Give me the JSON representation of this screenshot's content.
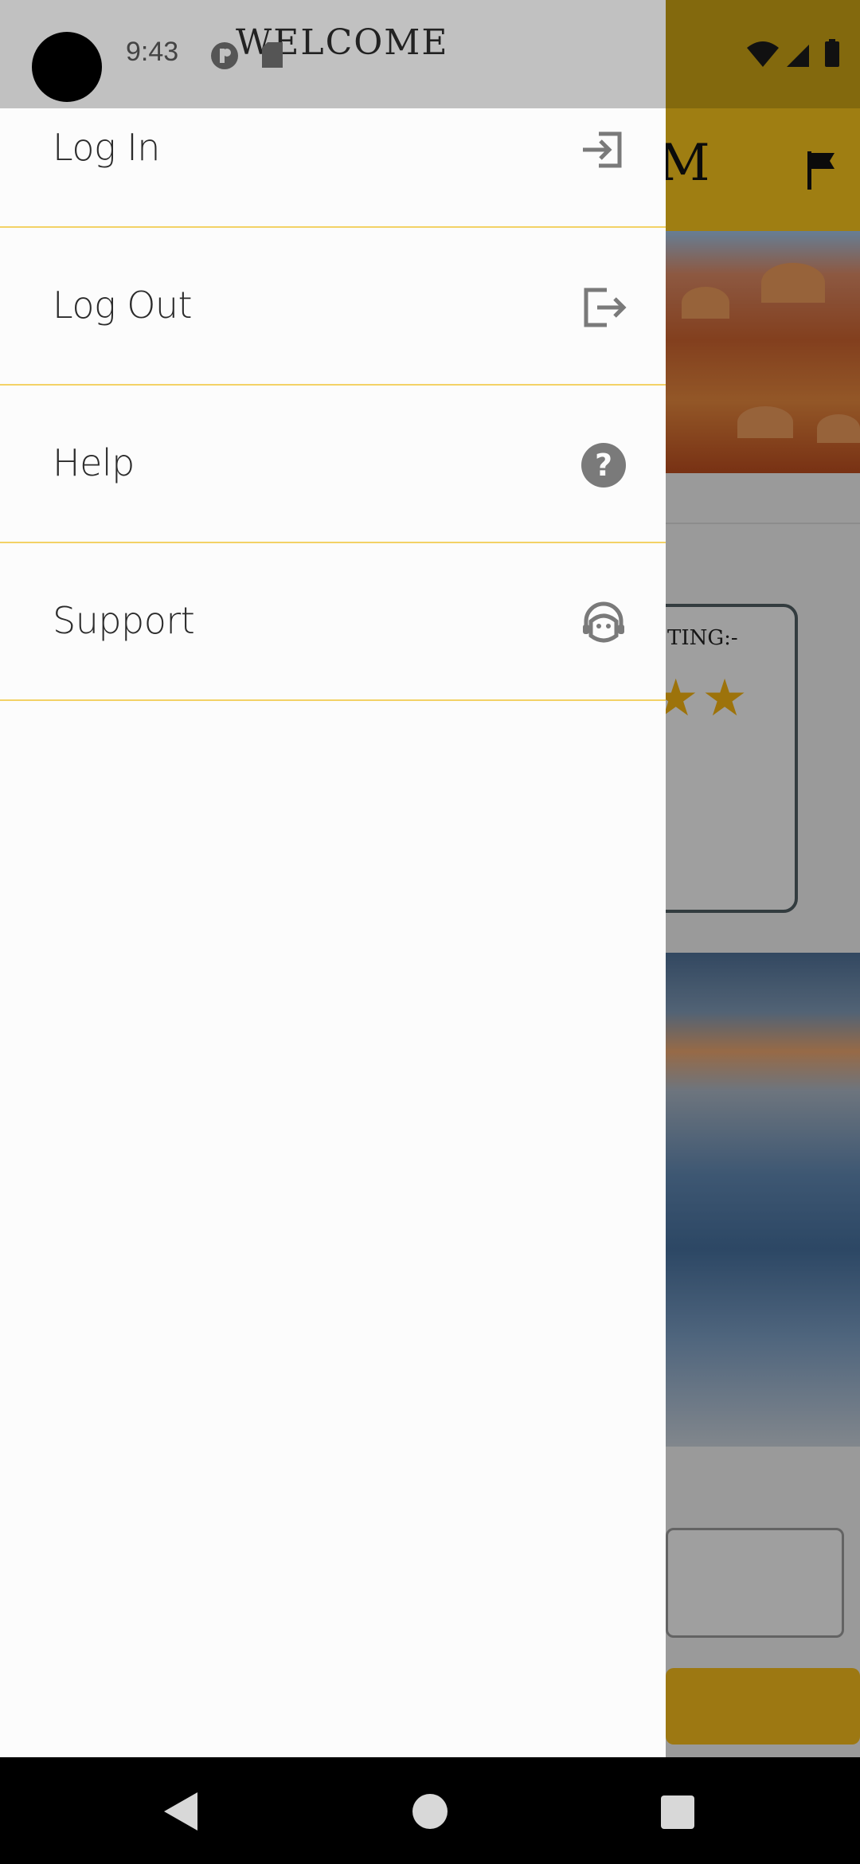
{
  "status_bar": {
    "time": "9:43"
  },
  "drawer": {
    "header_title": "WELCOME",
    "items": [
      {
        "label": "Log In",
        "icon": "login-icon"
      },
      {
        "label": "Log Out",
        "icon": "logout-icon"
      },
      {
        "label": "Help",
        "icon": "help-icon"
      },
      {
        "label": "Support",
        "icon": "support-agent-icon"
      }
    ]
  },
  "background": {
    "title_fragment": "M",
    "rating_fragment": "TING:-",
    "stars": "★★"
  },
  "colors": {
    "accent": "#F4C21C",
    "divider": "#F3D266",
    "drawer_bg": "#FCFCFC",
    "header_bg": "#C1C1C1",
    "star": "#F2B111"
  }
}
